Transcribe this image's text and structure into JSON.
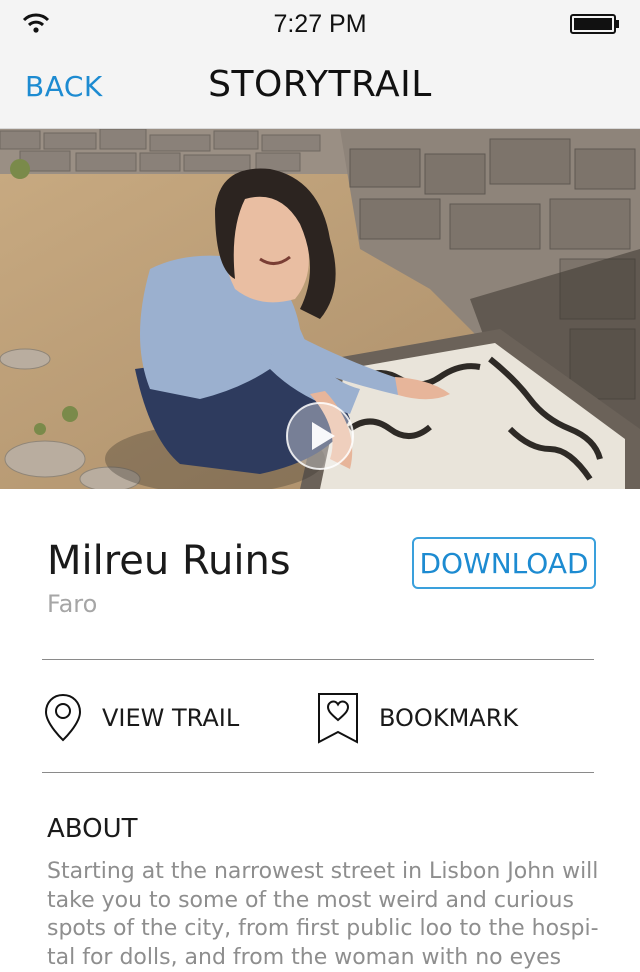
{
  "status_bar": {
    "time": "7:27 PM"
  },
  "nav": {
    "back_label": "BACK",
    "title": "STORYTRAIL"
  },
  "place": {
    "title": "Milreu Ruins",
    "location": "Faro"
  },
  "buttons": {
    "download_label": "DOWNLOAD"
  },
  "actions": {
    "view_trail_label": "VIEW TRAIL",
    "bookmark_label": "BOOKMARK"
  },
  "about": {
    "heading": "ABOUT",
    "text": "Starting at the narrowest street in Lisbon John will take you to some of the most weird and curious spots of the city, from first public loo to the hospi- tal for dolls, and from the woman with no eyes"
  },
  "colors": {
    "accent": "#1d8bd1",
    "bar_bg": "#f4f4f4",
    "muted_text": "#a6a6a6"
  },
  "icons": [
    "wifi-icon",
    "battery-icon",
    "play-icon",
    "location-pin-icon",
    "bookmark-heart-icon"
  ]
}
